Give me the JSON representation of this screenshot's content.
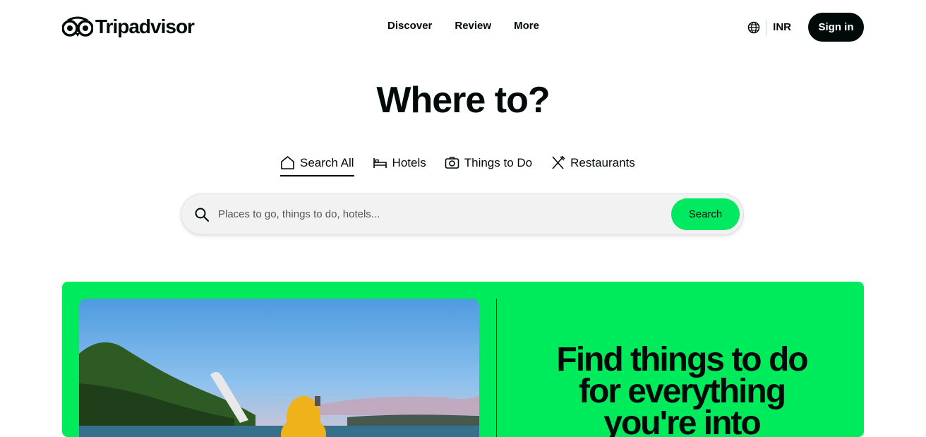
{
  "header": {
    "logo_text": "Tripadvisor",
    "nav": [
      "Discover",
      "Review",
      "More"
    ],
    "currency": "INR",
    "signin_label": "Sign in"
  },
  "hero": {
    "title": "Where to?"
  },
  "tabs": [
    {
      "label": "Search All",
      "icon": "home-icon",
      "active": true
    },
    {
      "label": "Hotels",
      "icon": "bed-icon",
      "active": false
    },
    {
      "label": "Things to Do",
      "icon": "camera-icon",
      "active": false
    },
    {
      "label": "Restaurants",
      "icon": "fork-knife-icon",
      "active": false
    }
  ],
  "search": {
    "placeholder": "Places to go, things to do, hotels...",
    "button_label": "Search"
  },
  "promo": {
    "line1": "Find things to do",
    "line2": "for everything",
    "line3": "you're into"
  },
  "colors": {
    "brand_dark": "#000a09",
    "accent_green": "#00eb5b"
  }
}
